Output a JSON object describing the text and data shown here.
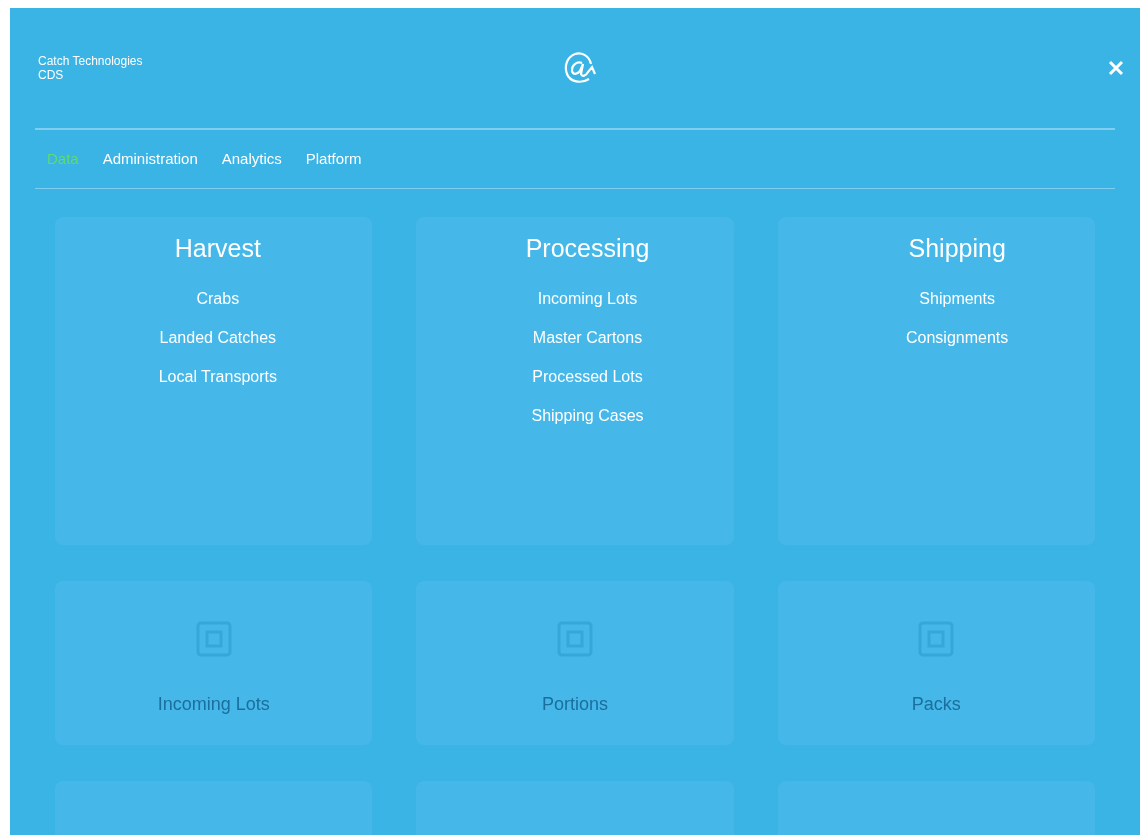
{
  "brand": {
    "company": "Catch Technologies",
    "product": "CDS"
  },
  "tabs": [
    {
      "label": "Data",
      "selected": true
    },
    {
      "label": "Administration",
      "selected": false
    },
    {
      "label": "Analytics",
      "selected": false
    },
    {
      "label": "Platform",
      "selected": false
    }
  ],
  "menu": [
    {
      "title": "Harvest",
      "items": [
        "Crabs",
        "Landed Catches",
        "Local Transports"
      ]
    },
    {
      "title": "Processing",
      "items": [
        "Incoming Lots",
        "Master Cartons",
        "Processed Lots",
        "Shipping Cases"
      ]
    },
    {
      "title": "Shipping",
      "items": [
        "Shipments",
        "Consignments"
      ]
    }
  ],
  "background_cards": [
    {
      "label": "Incoming Lots"
    },
    {
      "label": "Portions"
    },
    {
      "label": "Packs"
    }
  ]
}
